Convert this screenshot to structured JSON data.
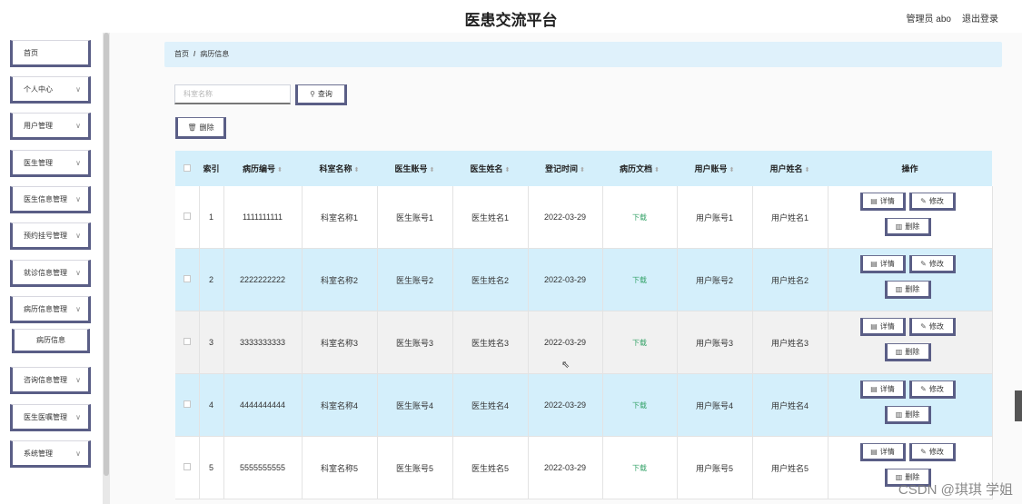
{
  "header": {
    "title": "医患交流平台",
    "admin_label": "管理员 abo",
    "logout_label": "退出登录"
  },
  "sidebar": {
    "items": [
      {
        "label": "首页",
        "has_chevron": false
      },
      {
        "label": "个人中心",
        "has_chevron": true
      },
      {
        "label": "用户管理",
        "has_chevron": true
      },
      {
        "label": "医生管理",
        "has_chevron": true
      },
      {
        "label": "医生信息管理",
        "has_chevron": true
      },
      {
        "label": "预约挂号管理",
        "has_chevron": true
      },
      {
        "label": "就诊信息管理",
        "has_chevron": true
      },
      {
        "label": "病历信息管理",
        "has_chevron": true
      },
      {
        "label": "病历信息",
        "has_chevron": false,
        "sub": true
      },
      {
        "label": "咨询信息管理",
        "has_chevron": true
      },
      {
        "label": "医生医嘱管理",
        "has_chevron": true
      },
      {
        "label": "系统管理",
        "has_chevron": true
      }
    ]
  },
  "breadcrumb": {
    "home": "首页",
    "separator": "/",
    "current": "病历信息"
  },
  "search": {
    "placeholder": "科室名称",
    "button_label": "查询"
  },
  "toolbar": {
    "delete_label": "删除"
  },
  "table": {
    "columns": [
      "索引",
      "病历编号",
      "科室名称",
      "医生账号",
      "医生姓名",
      "登记时间",
      "病历文档",
      "用户账号",
      "用户姓名",
      "操作"
    ],
    "rows": [
      {
        "index": "1",
        "record_no": "1111111111",
        "dept": "科室名称1",
        "doctor_account": "医生账号1",
        "doctor_name": "医生姓名1",
        "date": "2022-03-29",
        "doc": "下载",
        "user_account": "用户账号1",
        "user_name": "用户姓名1"
      },
      {
        "index": "2",
        "record_no": "2222222222",
        "dept": "科室名称2",
        "doctor_account": "医生账号2",
        "doctor_name": "医生姓名2",
        "date": "2022-03-29",
        "doc": "下载",
        "user_account": "用户账号2",
        "user_name": "用户姓名2"
      },
      {
        "index": "3",
        "record_no": "3333333333",
        "dept": "科室名称3",
        "doctor_account": "医生账号3",
        "doctor_name": "医生姓名3",
        "date": "2022-03-29",
        "doc": "下载",
        "user_account": "用户账号3",
        "user_name": "用户姓名3"
      },
      {
        "index": "4",
        "record_no": "4444444444",
        "dept": "科室名称4",
        "doctor_account": "医生账号4",
        "doctor_name": "医生姓名4",
        "date": "2022-03-29",
        "doc": "下载",
        "user_account": "用户账号4",
        "user_name": "用户姓名4"
      },
      {
        "index": "5",
        "record_no": "5555555555",
        "dept": "科室名称5",
        "doctor_account": "医生账号5",
        "doctor_name": "医生姓名5",
        "date": "2022-03-29",
        "doc": "下载",
        "user_account": "用户账号5",
        "user_name": "用户姓名5"
      }
    ],
    "action_labels": {
      "detail": "详情",
      "edit": "修改",
      "delete": "删除"
    }
  },
  "watermark": "CSDN @琪琪 学姐",
  "colors": {
    "header_bg": "#d4effb",
    "stripe": "#d4effb",
    "button_border": "#5a5e86",
    "doc_link": "#36a36a"
  },
  "icons": {
    "search": "magnifier",
    "delete": "trash",
    "detail": "document",
    "edit": "pencil",
    "chevron": "chevron-down"
  }
}
